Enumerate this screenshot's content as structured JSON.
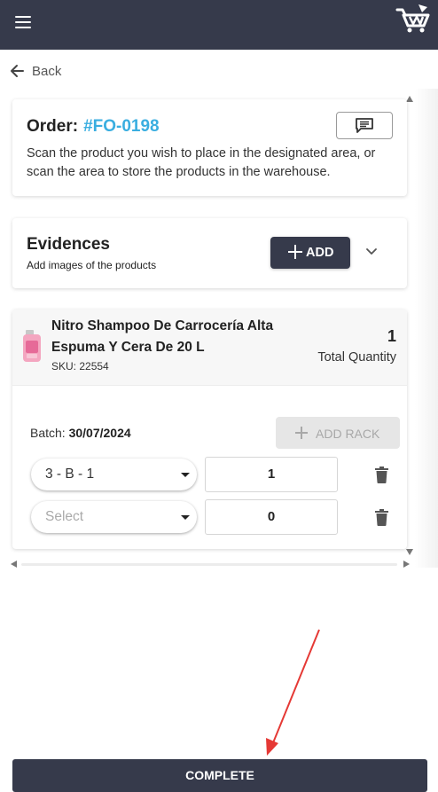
{
  "header": {
    "menu_icon": "hamburger-menu-icon",
    "logo_icon": "cart-logo-icon",
    "background": "#363a4b"
  },
  "nav": {
    "back_label": "Back",
    "back_icon": "arrow-left-icon"
  },
  "order": {
    "label": "Order:",
    "number": "#FO-0198",
    "number_color": "#3aaee0",
    "description": "Scan the product you wish to place in the designated area, or scan the area to store the products in the warehouse.",
    "comment_icon": "comment-icon"
  },
  "evidences": {
    "title": "Evidences",
    "subtitle": "Add images of the products",
    "add_label": "ADD",
    "expand_icon": "chevron-down-icon"
  },
  "product": {
    "name": "Nitro Shampoo De Carrocería Alta Espuma Y Cera De 20 L",
    "sku": "SKU: 22554",
    "quantity": "1",
    "quantity_label": "Total Quantity",
    "batch_label": "Batch:",
    "batch_value": "30/07/2024",
    "add_rack_label": "ADD RACK",
    "racks": [
      {
        "location": "3 - B - 1",
        "quantity": "1"
      },
      {
        "location": "Select",
        "quantity": "0"
      }
    ]
  },
  "footer": {
    "complete_label": "COMPLETE"
  },
  "annotation": {
    "arrow_color": "#e53935"
  }
}
